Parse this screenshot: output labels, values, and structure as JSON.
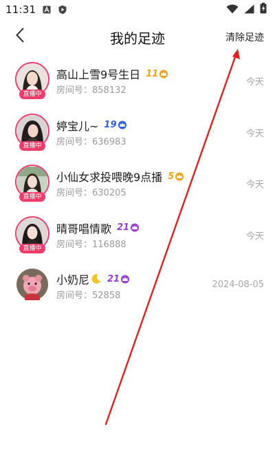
{
  "status_bar": {
    "time": "11:31",
    "icons": [
      "a-box-icon",
      "shield-icon",
      "wifi-icon",
      "signal-icon",
      "battery-charging-icon"
    ]
  },
  "header": {
    "title": "我的足迹",
    "clear_label": "清除足迹",
    "back_icon": "chevron-left-icon"
  },
  "colors": {
    "live_badge": "#ef3c6b",
    "level_orange": "#f0a21b",
    "level_blue": "#2f5fe0",
    "level_purple": "#9a3bd6",
    "arrow": "#e0201e"
  },
  "history": [
    {
      "name": "高山上雪9号生日",
      "live": true,
      "live_label": "直播中",
      "level": "11",
      "level_color": "orange",
      "room_label": "房间号：",
      "room_id": "858132",
      "time": "今天"
    },
    {
      "name": "婷宝儿~",
      "live": true,
      "live_label": "直播中",
      "level": "19",
      "level_color": "blue",
      "room_label": "房间号：",
      "room_id": "636983",
      "time": "今天"
    },
    {
      "name": "小仙女求投喂晚9点播",
      "live": true,
      "live_label": "直播中",
      "level": "5",
      "level_color": "orange",
      "room_label": "房间号：",
      "room_id": "630205",
      "time": "今天"
    },
    {
      "name": "晴哥唱情歌",
      "live": true,
      "live_label": "直播中",
      "level": "21",
      "level_color": "purple",
      "room_label": "房间号：",
      "room_id": "116888",
      "time": "今天"
    },
    {
      "name": "小奶尼",
      "live": false,
      "has_moon": true,
      "level": "21",
      "level_color": "purple",
      "room_label": "房间号：",
      "room_id": "52858",
      "time": "2024-08-05"
    }
  ]
}
